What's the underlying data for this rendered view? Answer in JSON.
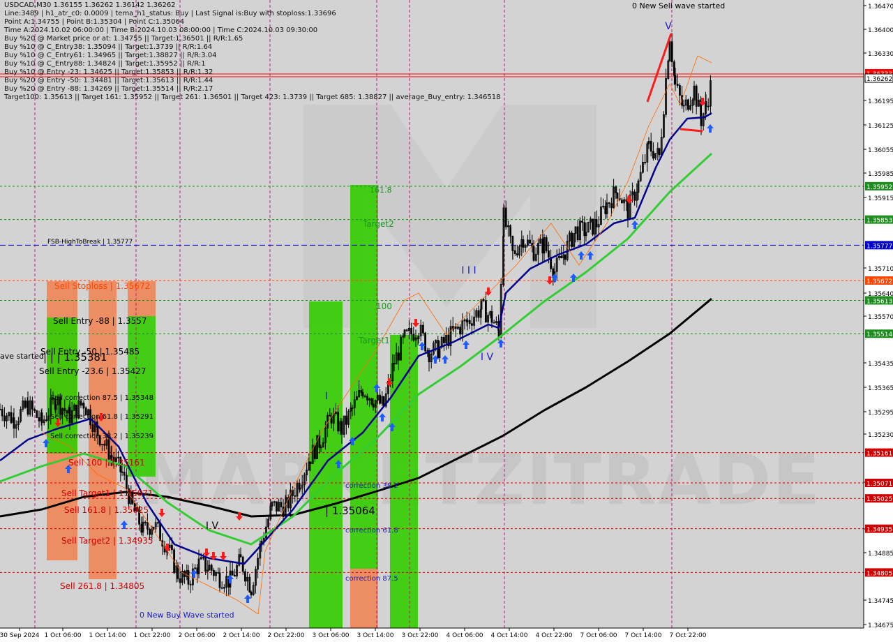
{
  "info_lines": [
    "USDCAD,M30  1.36155 1.36262 1.36142 1.36262",
    "Line:3489  | h1_atr_c0: 0.0009  | tema_h1_status: Buy  | Last Signal is:Buy with stoploss:1.33696",
    "Point A:1.34755  | Point B:1.35304  | Point C:1.35064",
    "Time A:2024.10.02 06:00:00  | Time B:2024.10.03 08:00:00  | Time C:2024.10.03 09:30:00",
    "Buy %20 @ Market price or at: 1.34755  || Target:1.36501  || R/R:1.65",
    "Buy %10 @ C_Entry38: 1.35094  || Target:1.3739  || R/R:1.64",
    "Buy %10 @ C_Entry61: 1.34965  || Target:1.38827  || R/R:3.04",
    "Buy %10 @ C_Entry88: 1.34824  || Target:1.35952  || R/R:1",
    "Buy %10 @ Entry -23: 1.34625  || Target:1.35853  || R/R:1.32",
    "Buy %20 @ Entry -50: 1.34481  || Target:1.35613  || R/R:1.44",
    "Buy %20 @ Entry -88: 1.34269  || Target:1.35514  || R/R:2.17",
    "Target100: 1.35613  || Target 161: 1.35952  || Target 261: 1.36501  || Target 423: 1.3739  || Target 685: 1.38827  || average_Buy_entry: 1.346518"
  ],
  "colors": {
    "background": "#d3d3d3",
    "candle": "#000000",
    "ma_fast": "#00008b",
    "ma_mid": "#32cd32",
    "ma_slow": "#000000",
    "buy_zone": "#33cc00",
    "sell_zone_green": "#33cc00",
    "stop_zone": "#f08050",
    "buy_arrow": "#1e5cff",
    "sell_arrow": "#ff1a1a",
    "watermark": "#bdbdbd"
  },
  "watermark": "MARKETZITRADE",
  "chart_data": {
    "type": "candlestick",
    "symbol": "USDCAD",
    "timeframe": "M30",
    "ylim": [
      1.3464,
      1.36505
    ],
    "price_axis_ticks": [
      "1.36470",
      "1.36400",
      "1.36330",
      "1.36195",
      "1.36125",
      "1.36055",
      "1.35985",
      "1.35915",
      "1.35710",
      "1.35640",
      "1.35570",
      "1.35435",
      "1.35365",
      "1.35295",
      "1.35230",
      "1.35090",
      "1.34955",
      "1.34885",
      "1.34745",
      "1.34675"
    ],
    "time_labels": [
      "30 Sep 2024",
      "1 Oct 06:00",
      "1 Oct 14:00",
      "1 Oct 22:00",
      "2 Oct 06:00",
      "2 Oct 14:00",
      "2 Oct 22:00",
      "3 Oct 06:00",
      "3 Oct 14:00",
      "3 Oct 22:00",
      "4 Oct 06:00",
      "4 Oct 14:00",
      "4 Oct 22:00",
      "7 Oct 06:00",
      "7 Oct 14:00",
      "7 Oct 22:00"
    ],
    "current_price": "1.36262",
    "current_price_upper": "1.36333",
    "horizontal_levels": [
      {
        "price": 1.35952,
        "label": "1.35952",
        "color": "#1e8c1e",
        "style": "dashed"
      },
      {
        "price": 1.35853,
        "label": "1.35853",
        "color": "#1e8c1e",
        "style": "dashed"
      },
      {
        "price": 1.35777,
        "label": "1.35777",
        "color": "#0000cc",
        "style": "dashed"
      },
      {
        "price": 1.35672,
        "label": "1.35672",
        "color": "#ff4500",
        "style": "dashed"
      },
      {
        "price": 1.35613,
        "label": "1.35613",
        "color": "#1e8c1e",
        "style": "dashed"
      },
      {
        "price": 1.35514,
        "label": "1.35514",
        "color": "#1e8c1e",
        "style": "dashed"
      },
      {
        "price": 1.35161,
        "label": "1.35161",
        "color": "#cc0000",
        "style": "dashed"
      },
      {
        "price": 1.35071,
        "label": "1.35071",
        "color": "#cc0000",
        "style": "dashed"
      },
      {
        "price": 1.35025,
        "label": "1.35025",
        "color": "#cc0000",
        "style": "dashed"
      },
      {
        "price": 1.34935,
        "label": "1.34935",
        "color": "#cc0000",
        "style": "dashed"
      },
      {
        "price": 1.34805,
        "label": "1.34805",
        "color": "#cc0000",
        "style": "dashed"
      }
    ],
    "annotations": [
      "0 New Sell wave started",
      "0 New Buy Wave started",
      "ave started",
      "FSB-HighToBreak | 1.35777",
      "Sell Stoploss | 1.35672",
      "Sell Entry -88 | 1.3557",
      "Sell Entry -50 | 1.35485",
      "Sell Entry -23.6 | 1.35427",
      "Sell correction 87.5 | 1.35348",
      "Sell correction 61.8 | 1.35291",
      "Sell correction 38.2 | 1.35239",
      "Sell 100 | 1.35161",
      "Sell Target1 | 1.35071",
      "Sell 161.8 | 1.35025",
      "Sell Target2 | 1.34935",
      "Sell 261.8 | 1.34805",
      "| | | 1.35381",
      "| 1.35064",
      "161.8",
      "Target2",
      "100",
      "Target1",
      "correction 38.2",
      "correction 61.8",
      "correction 87.5",
      "V",
      "I",
      "I I I",
      "I V",
      "I V",
      "V"
    ]
  }
}
